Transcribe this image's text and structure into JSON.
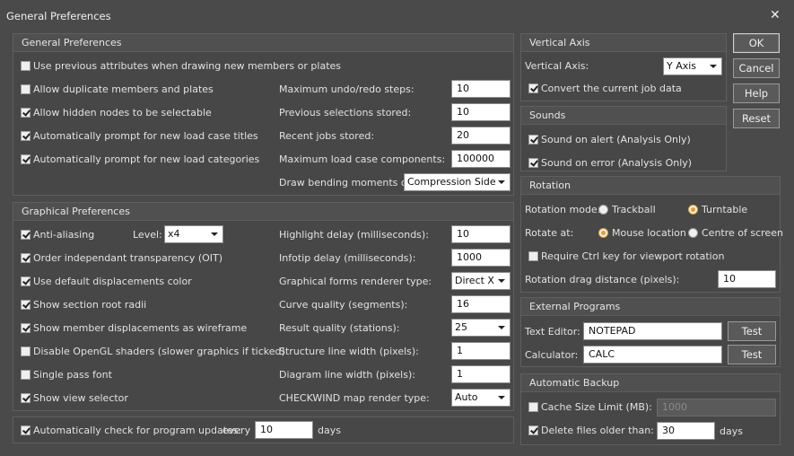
{
  "window": {
    "title": "General Preferences",
    "close_glyph": "✕"
  },
  "general": {
    "title": "General Preferences",
    "options": [
      {
        "label": "Use previous attributes when drawing new members or plates",
        "checked": false
      },
      {
        "label": "Allow duplicate members and plates",
        "checked": false
      },
      {
        "label": "Allow hidden nodes to be selectable",
        "checked": true
      },
      {
        "label": "Automatically prompt for new load case titles",
        "checked": true
      },
      {
        "label": "Automatically prompt for new load categories",
        "checked": true
      }
    ],
    "fields": [
      {
        "label": "Maximum undo/redo steps:",
        "value": "10"
      },
      {
        "label": "Previous selections stored:",
        "value": "10"
      },
      {
        "label": "Recent jobs stored:",
        "value": "20"
      },
      {
        "label": "Maximum load case components:",
        "value": "100000"
      }
    ],
    "bending": {
      "label": "Draw bending moments on:",
      "value": "Compression Side"
    }
  },
  "graphical": {
    "title": "Graphical Preferences",
    "options": [
      {
        "label": "Anti-aliasing",
        "checked": true
      },
      {
        "label": "Order independant transparency (OIT)",
        "checked": true
      },
      {
        "label": "Use default displacements color",
        "checked": true
      },
      {
        "label": "Show section root radii",
        "checked": true
      },
      {
        "label": "Show member displacements as wireframe",
        "checked": true
      },
      {
        "label": "Disable OpenGL shaders (slower graphics if ticked)",
        "checked": false
      },
      {
        "label": "Single pass font",
        "checked": false
      },
      {
        "label": "Show view selector",
        "checked": true
      }
    ],
    "level_label": "Level:",
    "level_value": "x4",
    "fields": [
      {
        "label": "Highlight delay (milliseconds):",
        "value": "10",
        "kind": "input"
      },
      {
        "label": "Infotip delay (milliseconds):",
        "value": "1000",
        "kind": "input"
      },
      {
        "label": "Graphical forms renderer type:",
        "value": "Direct X",
        "kind": "select"
      },
      {
        "label": "Curve quality (segments):",
        "value": "16",
        "kind": "input"
      },
      {
        "label": "Result quality (stations):",
        "value": "25",
        "kind": "select"
      },
      {
        "label": "Structure line width (pixels):",
        "value": "1",
        "kind": "input"
      },
      {
        "label": "Diagram line width (pixels):",
        "value": "1",
        "kind": "input"
      },
      {
        "label": "CHECKWIND map render type:",
        "value": "Auto",
        "kind": "select"
      }
    ]
  },
  "updates": {
    "label": "Automatically check for program updates:",
    "checked": true,
    "every": "every",
    "value": "10",
    "unit": "days"
  },
  "vertical_axis": {
    "title": "Vertical Axis",
    "label": "Vertical Axis:",
    "value": "Y Axis",
    "convert_label": "Convert the current job data",
    "convert_checked": true
  },
  "sounds": {
    "title": "Sounds",
    "alert_label": "Sound on alert (Analysis Only)",
    "alert_checked": true,
    "error_label": "Sound on error (Analysis Only)",
    "error_checked": true
  },
  "rotation": {
    "title": "Rotation",
    "mode_label": "Rotation mode:",
    "mode_options": [
      "Trackball",
      "Turntable"
    ],
    "mode_selected": "Turntable",
    "at_label": "Rotate at:",
    "at_options": [
      "Mouse location",
      "Centre of screen"
    ],
    "at_selected": "Mouse location",
    "ctrl_label": "Require Ctrl key for viewport rotation",
    "ctrl_checked": false,
    "drag_label": "Rotation drag distance (pixels):",
    "drag_value": "10"
  },
  "external": {
    "title": "External Programs",
    "editor_label": "Text Editor:",
    "editor_value": "NOTEPAD",
    "calc_label": "Calculator:",
    "calc_value": "CALC",
    "test_label": "Test"
  },
  "backup": {
    "title": "Automatic Backup",
    "cache_label": "Cache Size Limit (MB):",
    "cache_checked": false,
    "cache_value": "1000",
    "delete_label": "Delete files older than:",
    "delete_checked": true,
    "delete_value": "30",
    "delete_unit": "days"
  },
  "buttons": {
    "ok": "OK",
    "cancel": "Cancel",
    "help": "Help",
    "reset": "Reset"
  },
  "colors": {
    "background": "#4a4a4a",
    "panel": "#474747",
    "accent_radio": "#e8a020"
  }
}
